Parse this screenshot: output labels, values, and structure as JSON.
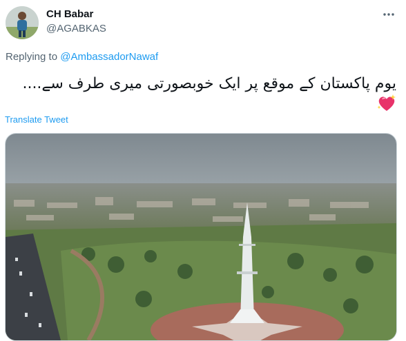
{
  "author": {
    "display_name": "CH Babar",
    "handle": "@AGABKAS",
    "avatar_icon": "avatar-person-icon"
  },
  "reply": {
    "prefix": "Replying to ",
    "mention": "@AmbassadorNawaf"
  },
  "tweet": {
    "text": "یوم پاکستان کے موقع پر ایک خوبصورتی میری طرف سے....",
    "emoji": "sparkling-heart-icon"
  },
  "actions": {
    "translate_label": "Translate Tweet",
    "more_icon": "more-options-icon"
  },
  "colors": {
    "link": "#1d9bf0",
    "secondary_text": "#536471",
    "primary_text": "#0f1419"
  }
}
